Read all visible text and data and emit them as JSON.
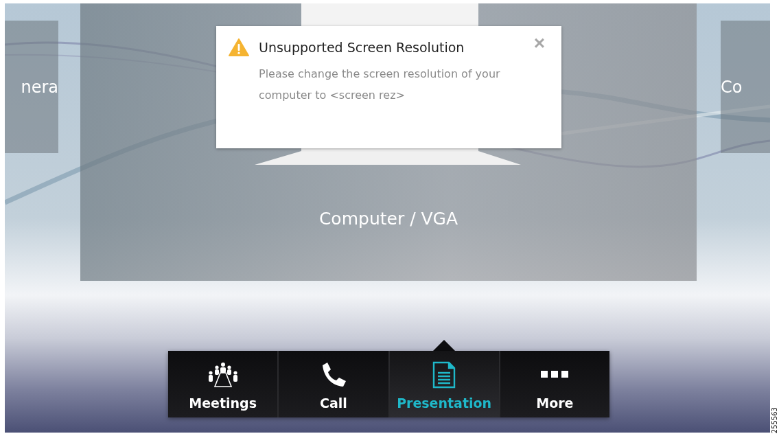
{
  "sources": [
    {
      "label": "nera",
      "selected": false
    },
    {
      "label": "Computer / VGA",
      "selected": true
    },
    {
      "label": "Co",
      "selected": false
    }
  ],
  "alert": {
    "title": "Unsupported Screen Resolution",
    "message": "Please change the screen resolution of your computer to <screen rez>",
    "close": "×"
  },
  "nav": [
    {
      "kind": "meetings",
      "label": "Meetings",
      "selected": false
    },
    {
      "kind": "call",
      "label": "Call",
      "selected": false
    },
    {
      "kind": "presentation",
      "label": "Presentation",
      "selected": true
    },
    {
      "kind": "more",
      "label": "More",
      "selected": false
    }
  ],
  "figure_id": "255563"
}
